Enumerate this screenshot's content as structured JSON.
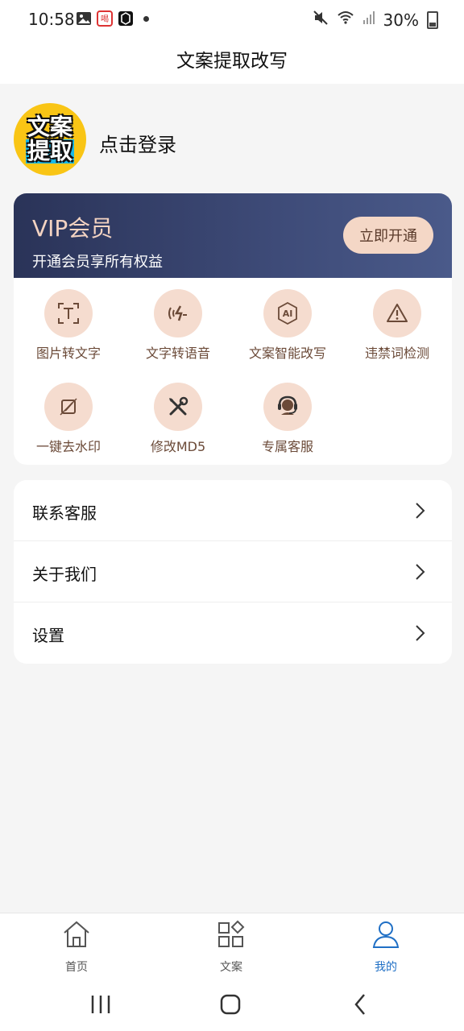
{
  "status_bar": {
    "time": "10:58",
    "battery": "30%",
    "notification_icons": [
      "gallery-icon",
      "app-badge-icon",
      "app-icon"
    ],
    "system_icons": [
      "mute-icon",
      "wifi-icon",
      "signal-icon",
      "battery-icon"
    ]
  },
  "app_bar": {
    "title": "文案提取改写"
  },
  "profile": {
    "avatar_line1": "文案",
    "avatar_line2": "提取",
    "login_label": "点击登录"
  },
  "vip": {
    "title": "VIP会员",
    "subtitle": "开通会员享所有权益",
    "button_label": "立即开通",
    "banner_color": "#2a3358",
    "accent_color": "#f4d7c6"
  },
  "features": [
    {
      "label": "图片转文字",
      "icon": "image-to-text-icon"
    },
    {
      "label": "文字转语音",
      "icon": "text-to-speech-icon"
    },
    {
      "label": "文案智能改写",
      "icon": "ai-rewrite-icon"
    },
    {
      "label": "违禁词检测",
      "icon": "warning-icon"
    },
    {
      "label": "一键去水印",
      "icon": "remove-watermark-icon"
    },
    {
      "label": "修改MD5",
      "icon": "tools-icon"
    },
    {
      "label": "专属客服",
      "icon": "customer-service-icon"
    }
  ],
  "menu": [
    {
      "label": "联系客服"
    },
    {
      "label": "关于我们"
    },
    {
      "label": "设置"
    }
  ],
  "tabs": [
    {
      "label": "首页",
      "icon": "home-icon",
      "active": false
    },
    {
      "label": "文案",
      "icon": "apps-icon",
      "active": false
    },
    {
      "label": "我的",
      "icon": "user-icon",
      "active": true
    }
  ],
  "colors": {
    "active_tab": "#1f6fc5",
    "feature_circle": "#f5dccf",
    "feature_label": "#6b4a38"
  }
}
